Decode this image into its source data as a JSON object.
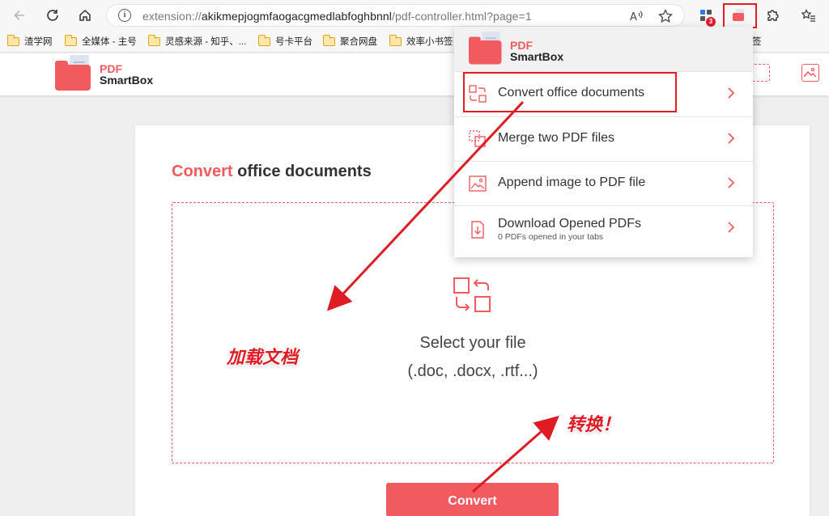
{
  "browser": {
    "url_prefix": "extension://",
    "url_host": "akikmepjogmfaogacgmedlabfoghbnnl",
    "url_path": "/pdf-controller.html?page=1",
    "extensions_badge": "3"
  },
  "bookmarks": [
    {
      "label": "渣学网"
    },
    {
      "label": "全媒体 - 主号"
    },
    {
      "label": "灵感来源 - 知乎、..."
    },
    {
      "label": "号卡平台"
    },
    {
      "label": "聚合网盘"
    },
    {
      "label": "效率小书签"
    },
    {
      "label": "签"
    }
  ],
  "app": {
    "logo_line1": "PDF",
    "logo_line2": "SmartBox"
  },
  "main": {
    "title_accent": "Convert",
    "title_rest": " office documents",
    "dropzone_line1": "Select your file",
    "dropzone_line2": "(.doc, .docx, .rtf...)",
    "convert_label": "Convert"
  },
  "popup": {
    "logo_line1": "PDF",
    "logo_line2": "SmartBox",
    "items": [
      {
        "label": "Convert office documents",
        "sublabel": ""
      },
      {
        "label": "Merge two PDF files",
        "sublabel": ""
      },
      {
        "label": "Append image to PDF file",
        "sublabel": ""
      },
      {
        "label": "Download Opened PDFs",
        "sublabel": "0 PDFs opened in your tabs"
      }
    ]
  },
  "annotations": {
    "load_doc": "加载文档",
    "convert": "转换！"
  },
  "colors": {
    "accent": "#f15a5e",
    "highlight_box": "#e11d1d",
    "annotation": "#e01b24"
  }
}
